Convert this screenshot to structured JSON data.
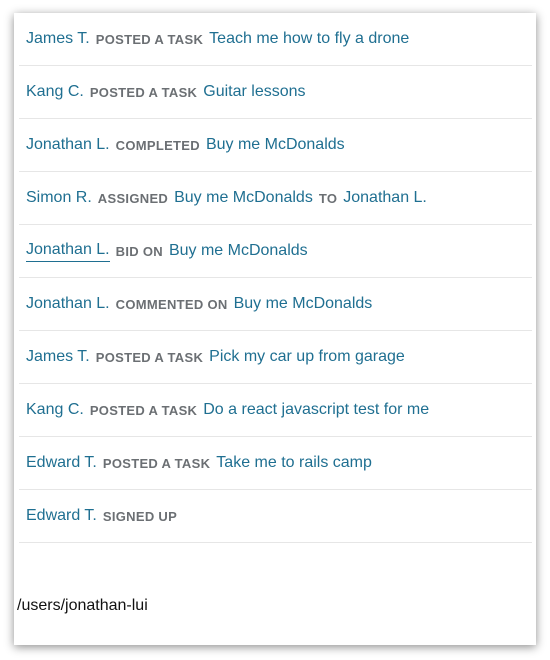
{
  "feed": {
    "items": [
      {
        "name": "James T.",
        "verb": "POSTED A TASK",
        "task": "Teach me how to fly a drone"
      },
      {
        "name": "Kang C.",
        "verb": "POSTED A TASK",
        "task": "Guitar lessons"
      },
      {
        "name": "Jonathan L.",
        "verb": "COMPLETED",
        "task": "Buy me McDonalds"
      },
      {
        "name": "Simon R.",
        "verb": "ASSIGNED",
        "task": "Buy me McDonalds",
        "connector": "TO",
        "target": "Jonathan L."
      },
      {
        "name": "Jonathan L.",
        "verb": "BID ON",
        "task": "Buy me McDonalds"
      },
      {
        "name": "Jonathan L.",
        "verb": "COMMENTED ON",
        "task": "Buy me McDonalds"
      },
      {
        "name": "James T.",
        "verb": "POSTED A TASK",
        "task": "Pick my car up from garage"
      },
      {
        "name": "Kang C.",
        "verb": "POSTED A TASK",
        "task": "Do a react javascript test for me"
      },
      {
        "name": "Edward T.",
        "verb": "POSTED A TASK",
        "task": "Take me to rails camp"
      },
      {
        "name": "Edward T.",
        "verb": "SIGNED UP"
      }
    ]
  },
  "status_bar": {
    "url": "/users/jonathan-lui"
  },
  "colors": {
    "link": "#1f6f91",
    "verb": "#6b6f73",
    "divider": "#e6e6e6"
  }
}
